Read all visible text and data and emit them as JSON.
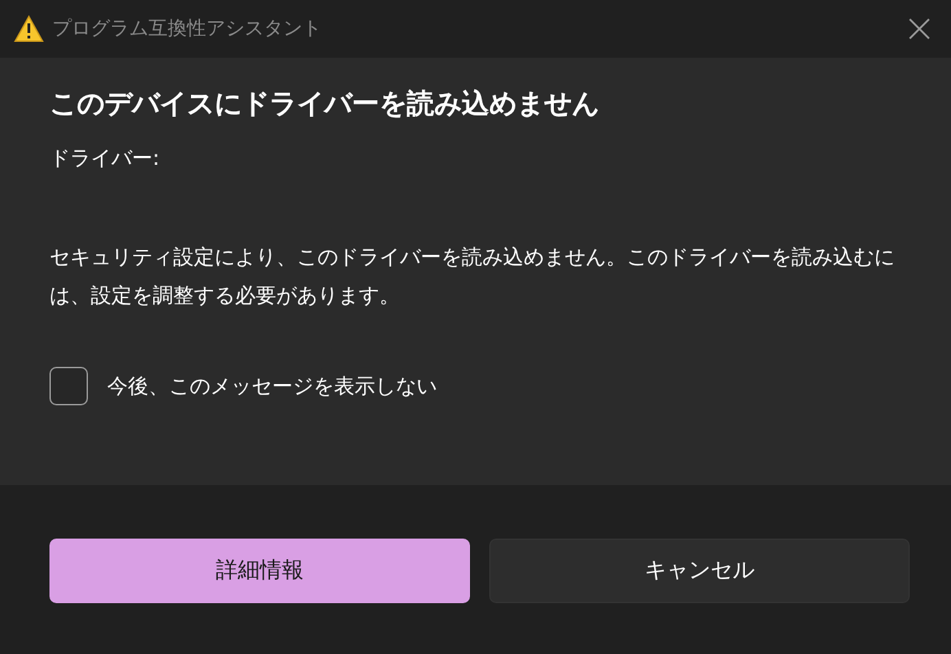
{
  "window": {
    "title": "プログラム互換性アシスタント"
  },
  "heading": "このデバイスにドライバーを読み込めません",
  "driver_label": "ドライバー:",
  "message": "セキュリティ設定により、このドライバーを読み込めません。このドライバーを読み込むには、設定を調整する必要があります。",
  "checkbox": {
    "label": "今後、このメッセージを表示しない",
    "checked": false
  },
  "buttons": [
    {
      "label": "詳細情報",
      "kind": "primary"
    },
    {
      "label": "キャンセル",
      "kind": "secondary"
    }
  ]
}
